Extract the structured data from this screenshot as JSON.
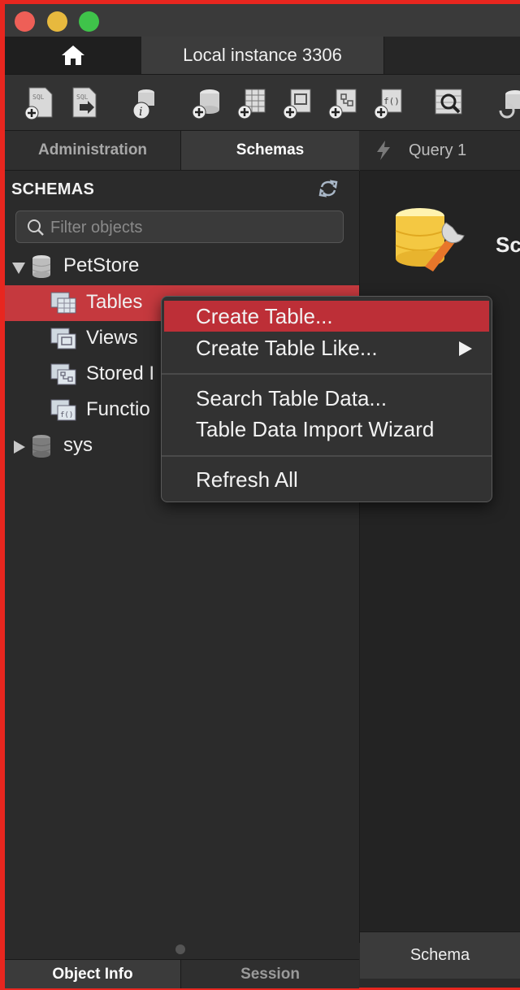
{
  "window": {
    "traffic_lights": {
      "close": "#ee5f57",
      "minimize": "#e7b93e",
      "zoom": "#3fc34a"
    },
    "accent_border": "#e8261f"
  },
  "tabs": {
    "home_icon": "home-icon",
    "connection_label": "Local instance 3306"
  },
  "toolbar": {
    "icons": [
      "new-sql-tab-icon",
      "open-sql-file-icon",
      "schema-inspector-icon",
      "create-schema-icon",
      "create-table-icon",
      "create-view-icon",
      "create-procedure-icon",
      "create-function-icon",
      "search-table-data-icon",
      "reconnect-icon"
    ]
  },
  "sidebar": {
    "tabs": [
      {
        "label": "Administration",
        "active": false
      },
      {
        "label": "Schemas",
        "active": true
      }
    ],
    "header": "SCHEMAS",
    "refresh_icon": "refresh-icon",
    "search": {
      "placeholder": "Filter objects",
      "value": ""
    },
    "tree": [
      {
        "label": "PetStore",
        "expanded": true
      },
      {
        "label": "Tables",
        "selected": true
      },
      {
        "label": "Views"
      },
      {
        "label": "Stored Procedures",
        "visible_label": "Stored I"
      },
      {
        "label": "Functions",
        "visible_label": "Functio"
      },
      {
        "label": "sys",
        "expanded": false
      }
    ],
    "bottom_tabs": [
      {
        "label": "Object Info",
        "active": true
      },
      {
        "label": "Session",
        "active": false
      }
    ]
  },
  "query_tab": {
    "label": "Query 1",
    "icon": "lightning-icon"
  },
  "main": {
    "partial_title": "Sc"
  },
  "context_menu": {
    "items": [
      {
        "label": "Create Table...",
        "highlighted": true
      },
      {
        "label": "Create Table Like...",
        "submenu": true
      },
      {
        "label": "Search Table Data..."
      },
      {
        "label": "Table Data Import Wizard"
      },
      {
        "label": "Refresh All"
      }
    ],
    "highlight_color": "#bd2f37"
  },
  "bottom_right_tab": {
    "label": "Schema"
  }
}
